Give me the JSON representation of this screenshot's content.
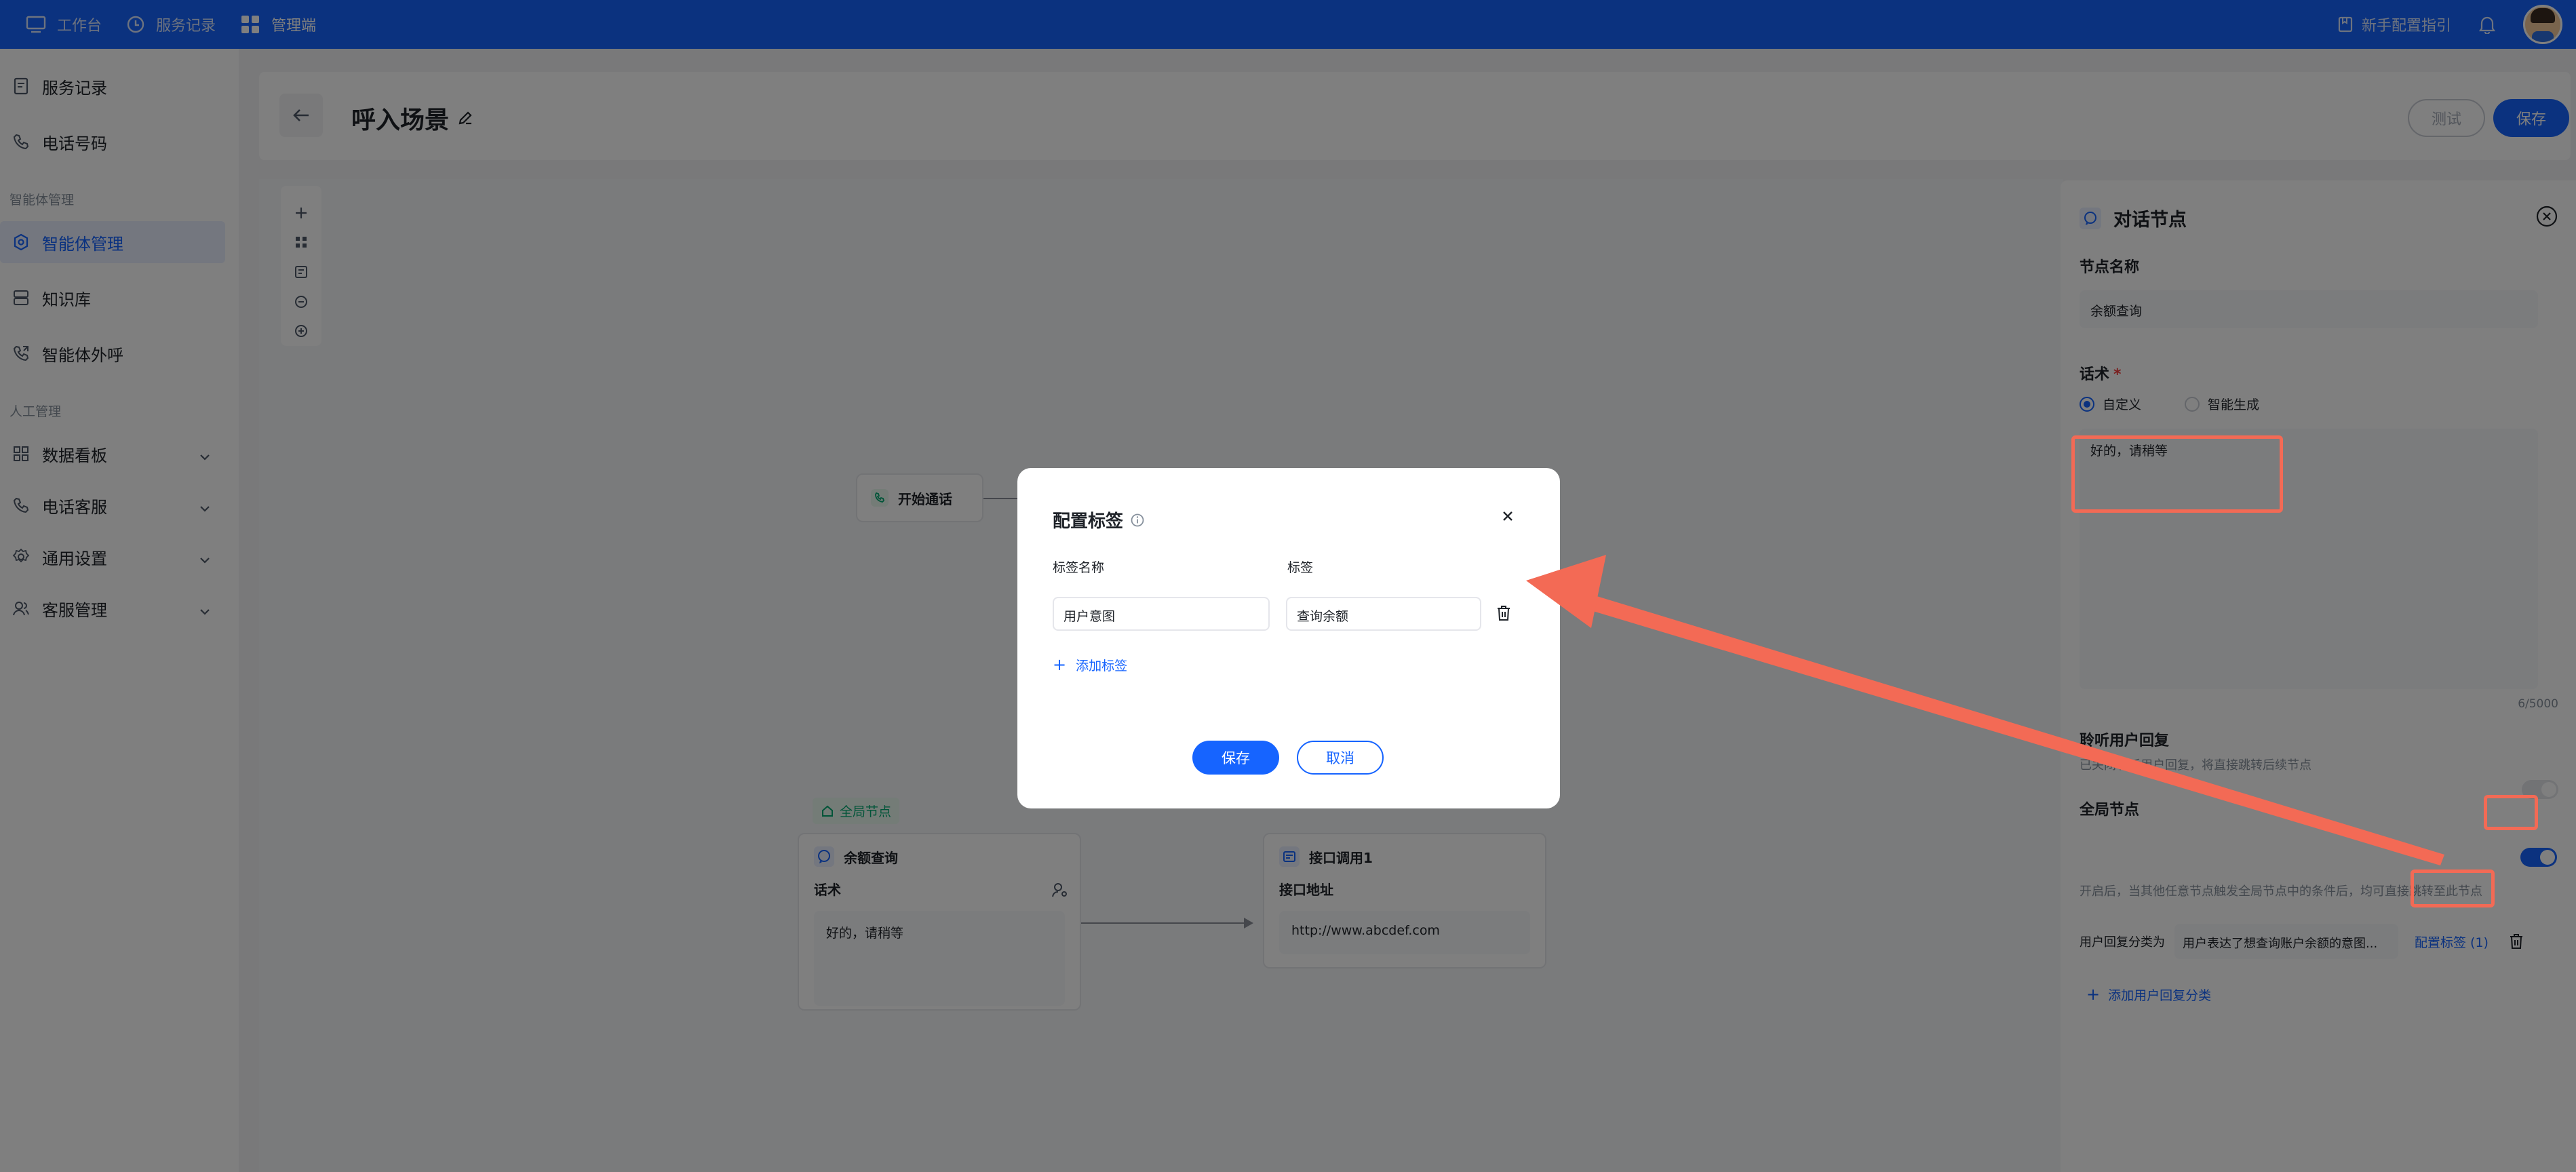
{
  "topnav": {
    "items": [
      {
        "label": "工作台",
        "icon": "monitor-icon"
      },
      {
        "label": "服务记录",
        "icon": "clock-icon"
      },
      {
        "label": "管理端",
        "icon": "grid-icon"
      }
    ],
    "guide_label": "新手配置指引"
  },
  "sidebar": {
    "items": [
      {
        "label": "服务记录",
        "icon": "document-icon"
      },
      {
        "label": "电话号码",
        "icon": "phone-icon"
      }
    ],
    "group1": "智能体管理",
    "group1_items": [
      {
        "label": "智能体管理",
        "icon": "agent-icon",
        "active": true
      },
      {
        "label": "知识库",
        "icon": "database-icon"
      },
      {
        "label": "智能体外呼",
        "icon": "phone-out-icon"
      }
    ],
    "group2": "人工管理",
    "group2_items": [
      {
        "label": "数据看板",
        "icon": "dashboard-icon"
      },
      {
        "label": "电话客服",
        "icon": "phone-icon"
      },
      {
        "label": "通用设置",
        "icon": "gear-icon"
      },
      {
        "label": "客服管理",
        "icon": "users-icon"
      }
    ]
  },
  "header": {
    "title": "呼入场景",
    "test_label": "测试",
    "save_label": "保存"
  },
  "canvas": {
    "start_node": "开始通话",
    "global_tag": "全局节点",
    "query_node": {
      "title": "余额查询",
      "label": "话术",
      "text": "好的，请稍等"
    },
    "api_node": {
      "title": "接口调用1",
      "label": "接口地址",
      "url": "http://www.abcdef.com"
    }
  },
  "panel": {
    "title": "对话节点",
    "name_label": "节点名称",
    "name_value": "余额查询",
    "speech_label": "话术",
    "required_mark": "*",
    "radio_custom": "自定义",
    "radio_ai": "智能生成",
    "speech_text": "好的，请稍等",
    "counter": "6/5000",
    "listen_label": "聆听用户回复",
    "listen_hint": "已关闭聆听用户回复，将直接跳转后续节点",
    "global_label": "全局节点",
    "global_hint": "开启后，当其他任意节点触发全局节点中的条件后，均可直接跳转至此节点",
    "route_label": "用户回复分类为",
    "route_value": "用户表达了想查询账户余额的意图...",
    "config_tag_link": "配置标签 (1)",
    "add_route": "添加用户回复分类"
  },
  "modal": {
    "title": "配置标签",
    "col_name": "标签名称",
    "col_tag": "标签",
    "name_value": "用户意图",
    "tag_value": "查询余额",
    "add_tag": "添加标签",
    "save": "保存",
    "cancel": "取消"
  },
  "colors": {
    "primary": "#1664ff",
    "annotation": "#f36a55",
    "success": "#00a870"
  }
}
